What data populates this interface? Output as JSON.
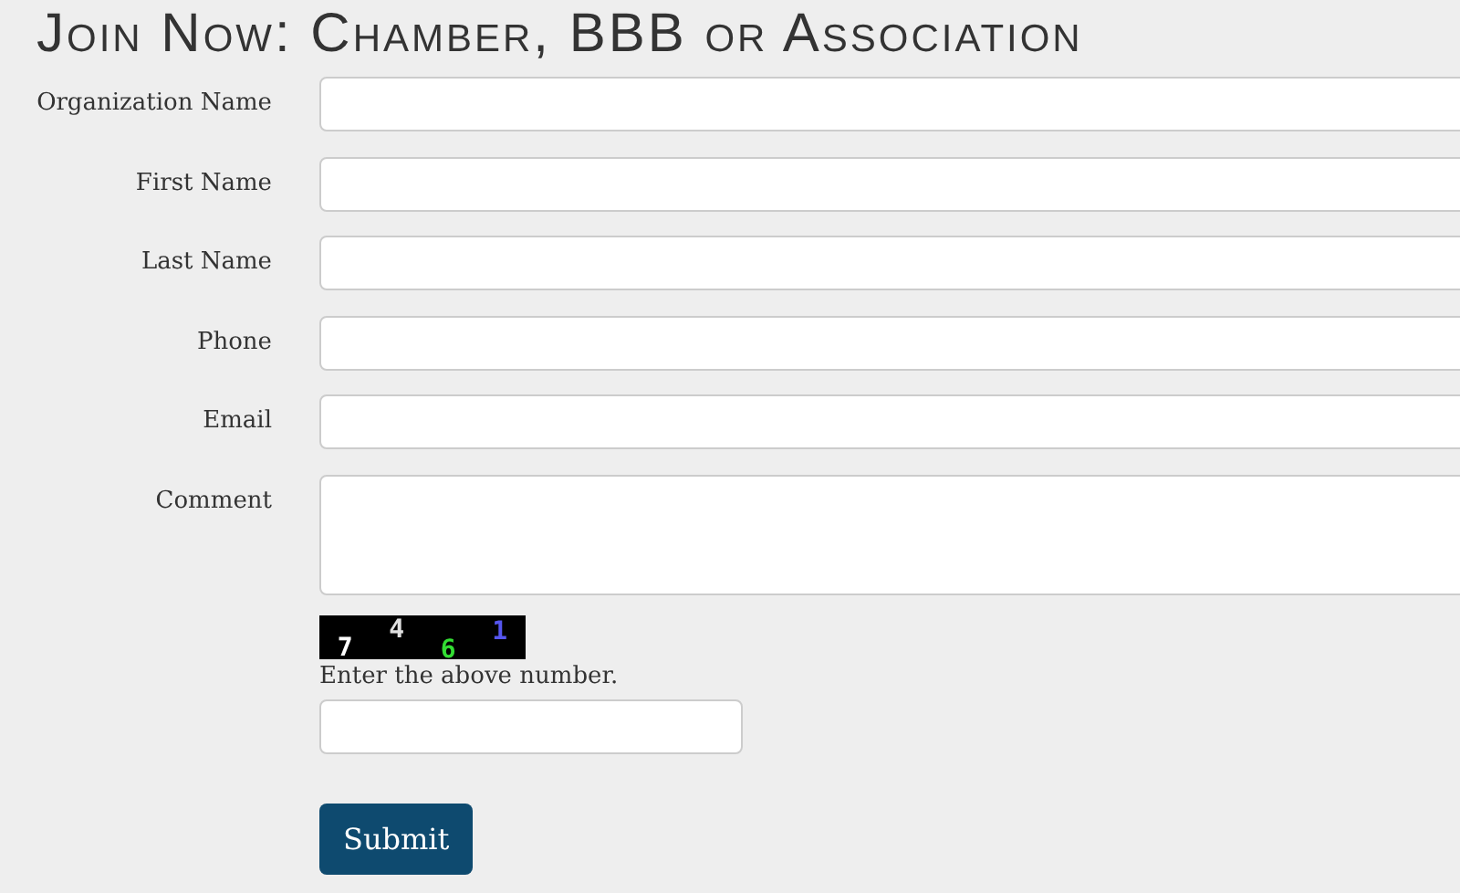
{
  "title": "Join Now: Chamber, BBB or Association",
  "fields": [
    {
      "label": "Organization Name",
      "kind": "input"
    },
    {
      "label": "First Name",
      "kind": "input"
    },
    {
      "label": "Last Name",
      "kind": "input"
    },
    {
      "label": "Phone",
      "kind": "input"
    },
    {
      "label": "Email",
      "kind": "input"
    },
    {
      "label": "Comment",
      "kind": "textarea"
    }
  ],
  "captcha": {
    "digits": [
      {
        "text": "7",
        "color": "#ffffff"
      },
      {
        "text": "4",
        "color": "#e0e0e0"
      },
      {
        "text": "6",
        "color": "#33dd33"
      },
      {
        "text": "1",
        "color": "#5555ee"
      }
    ],
    "prompt": "Enter the above number."
  },
  "submit": "Submit"
}
